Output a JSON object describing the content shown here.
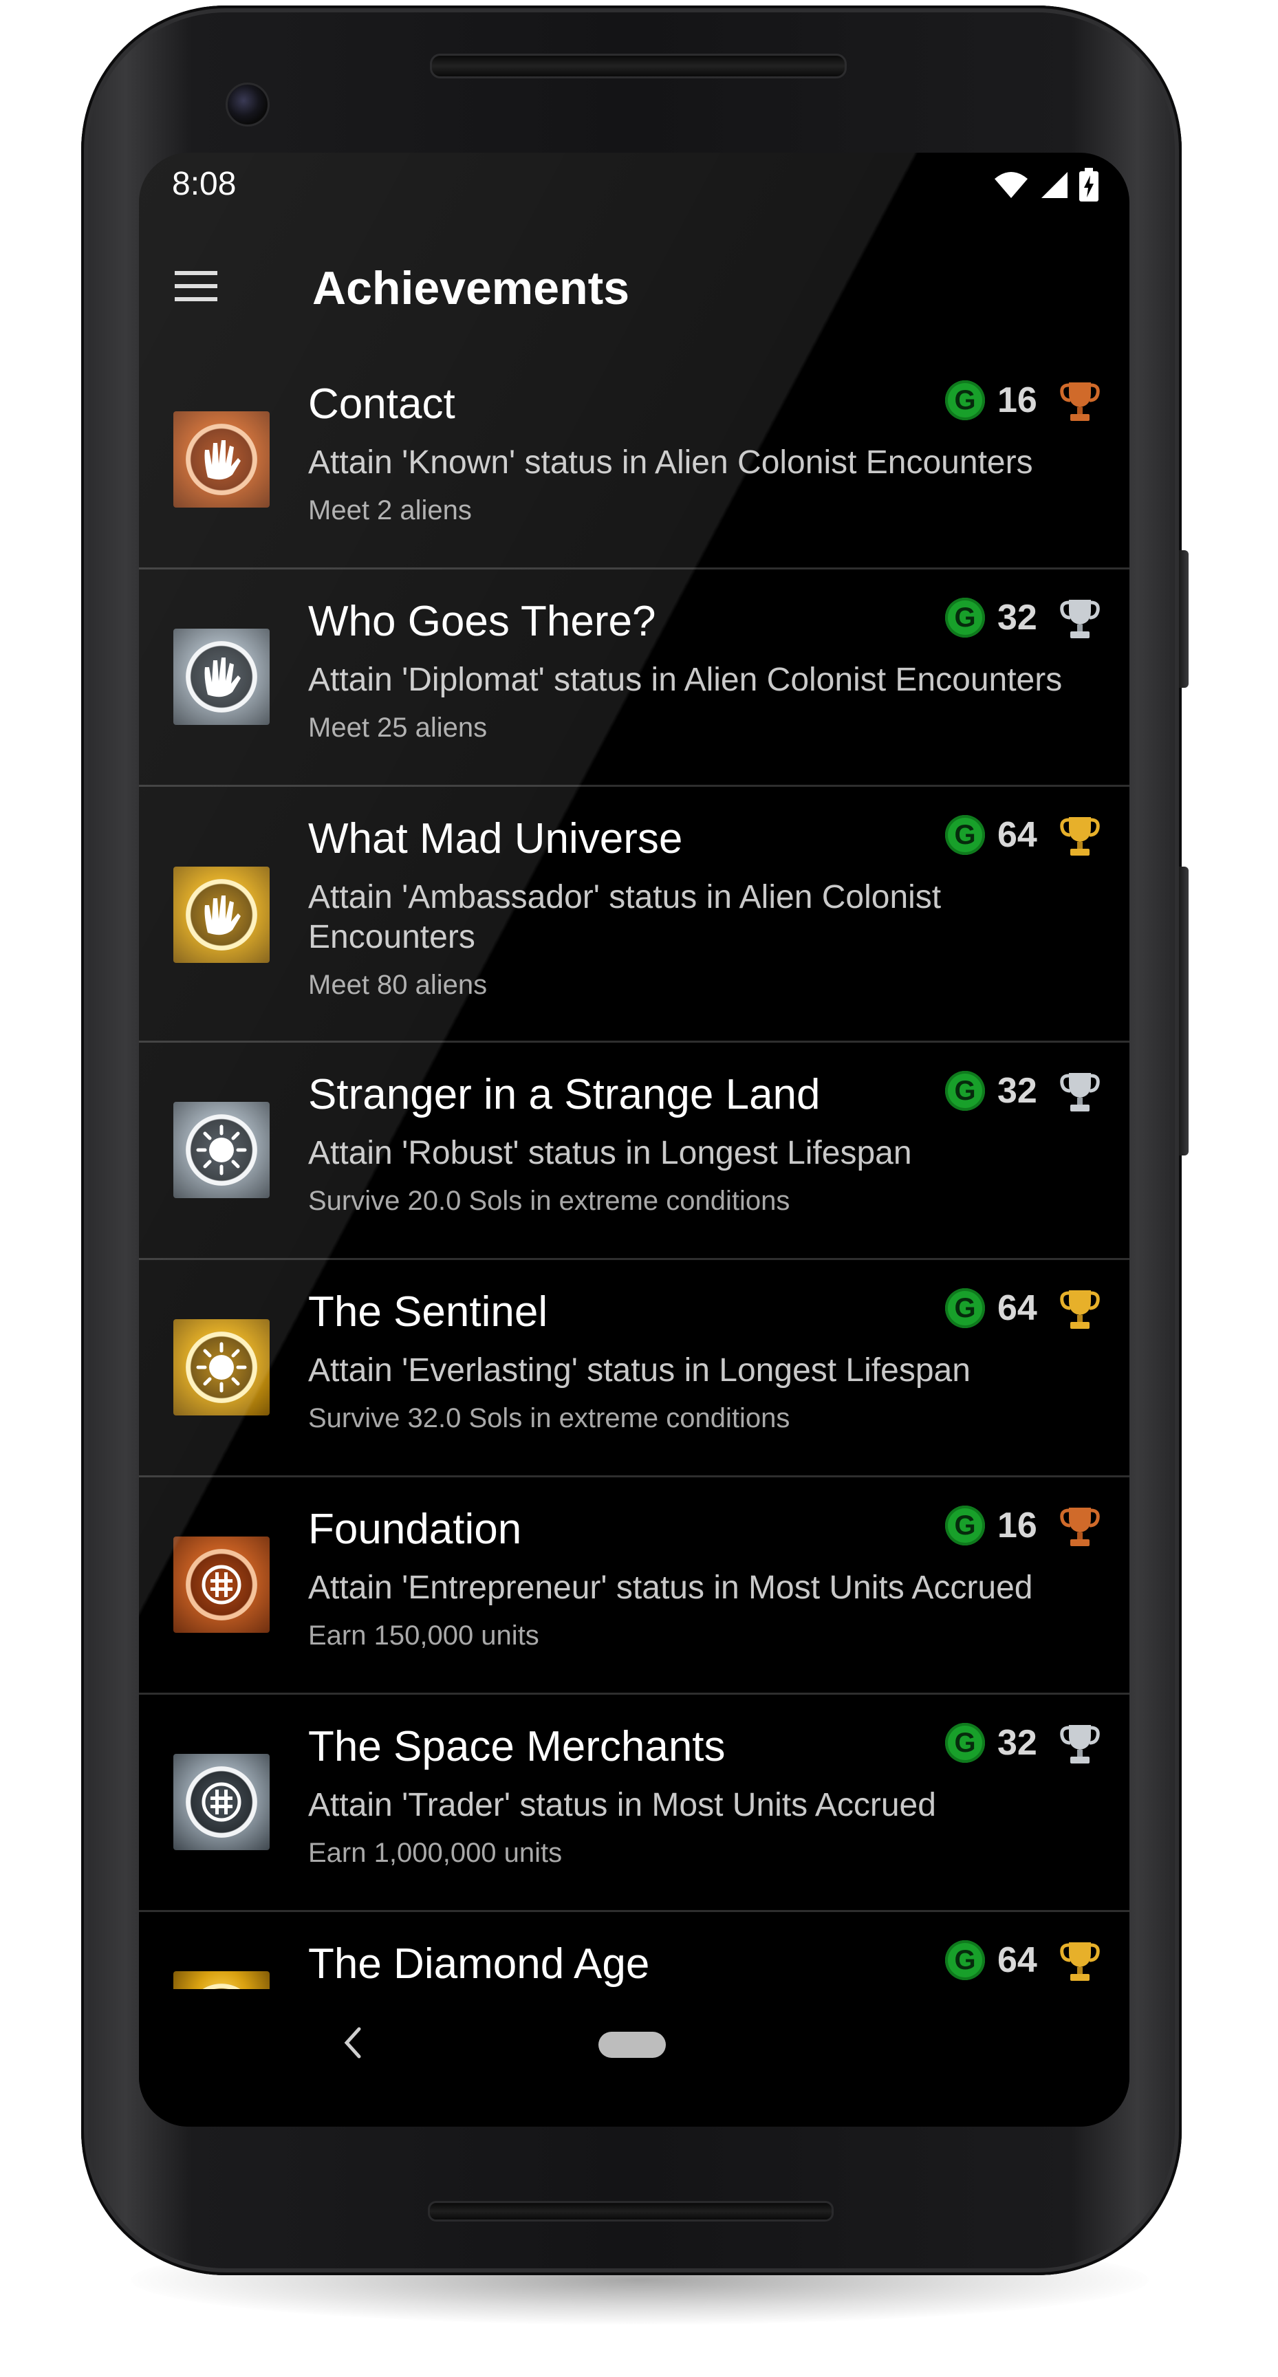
{
  "status_bar": {
    "time": "8:08",
    "icons": [
      "wifi-icon",
      "cellular-signal-icon",
      "battery-charging-icon"
    ]
  },
  "app_bar": {
    "menu_icon": "hamburger-menu-icon",
    "title": "Achievements"
  },
  "colors": {
    "background": "#000000",
    "gamerscore_green": "#18a02a",
    "bronze": "#c25d22",
    "silver": "#94a0aa",
    "gold": "#d9a111"
  },
  "achievements": [
    {
      "title": "Contact",
      "description": "Attain 'Known' status in Alien Colonist Encounters",
      "requirement": "Meet 2 aliens",
      "gamerscore": "16",
      "tier": "bronze",
      "badge_icon": "alien-hand-icon"
    },
    {
      "title": "Who Goes There?",
      "description": "Attain 'Diplomat' status in Alien Colonist Encounters",
      "requirement": "Meet 25 aliens",
      "gamerscore": "32",
      "tier": "silver",
      "badge_icon": "alien-hand-icon"
    },
    {
      "title": "What Mad Universe",
      "description": "Attain 'Ambassador' status in Alien Colonist Encounters",
      "requirement": "Meet 80 aliens",
      "gamerscore": "64",
      "tier": "gold",
      "badge_icon": "alien-hand-icon"
    },
    {
      "title": "Stranger in a Strange Land",
      "description": "Attain 'Robust' status in Longest Lifespan",
      "requirement": "Survive 20.0 Sols in extreme conditions",
      "gamerscore": "32",
      "tier": "silver",
      "badge_icon": "sun-icon"
    },
    {
      "title": "The Sentinel",
      "description": "Attain 'Everlasting' status in Longest Lifespan",
      "requirement": "Survive 32.0 Sols in extreme conditions",
      "gamerscore": "64",
      "tier": "gold",
      "badge_icon": "sun-icon"
    },
    {
      "title": "Foundation",
      "description": "Attain 'Entrepreneur' status in Most Units Accrued",
      "requirement": "Earn 150,000 units",
      "gamerscore": "16",
      "tier": "bronze",
      "badge_icon": "units-coin-icon"
    },
    {
      "title": "The Space Merchants",
      "description": "Attain 'Trader' status in Most Units Accrued",
      "requirement": "Earn 1,000,000 units",
      "gamerscore": "32",
      "tier": "silver",
      "badge_icon": "units-coin-icon"
    },
    {
      "title": "The Diamond Age",
      "description": "",
      "requirement": "",
      "gamerscore": "64",
      "tier": "gold",
      "badge_icon": "units-coin-icon"
    }
  ],
  "gamerscore_icon": {
    "letter": "G",
    "icon": "gamerscore-g-icon"
  },
  "nav_bar": {
    "back_icon": "back-chevron-icon",
    "home_icon": "home-pill-icon"
  }
}
